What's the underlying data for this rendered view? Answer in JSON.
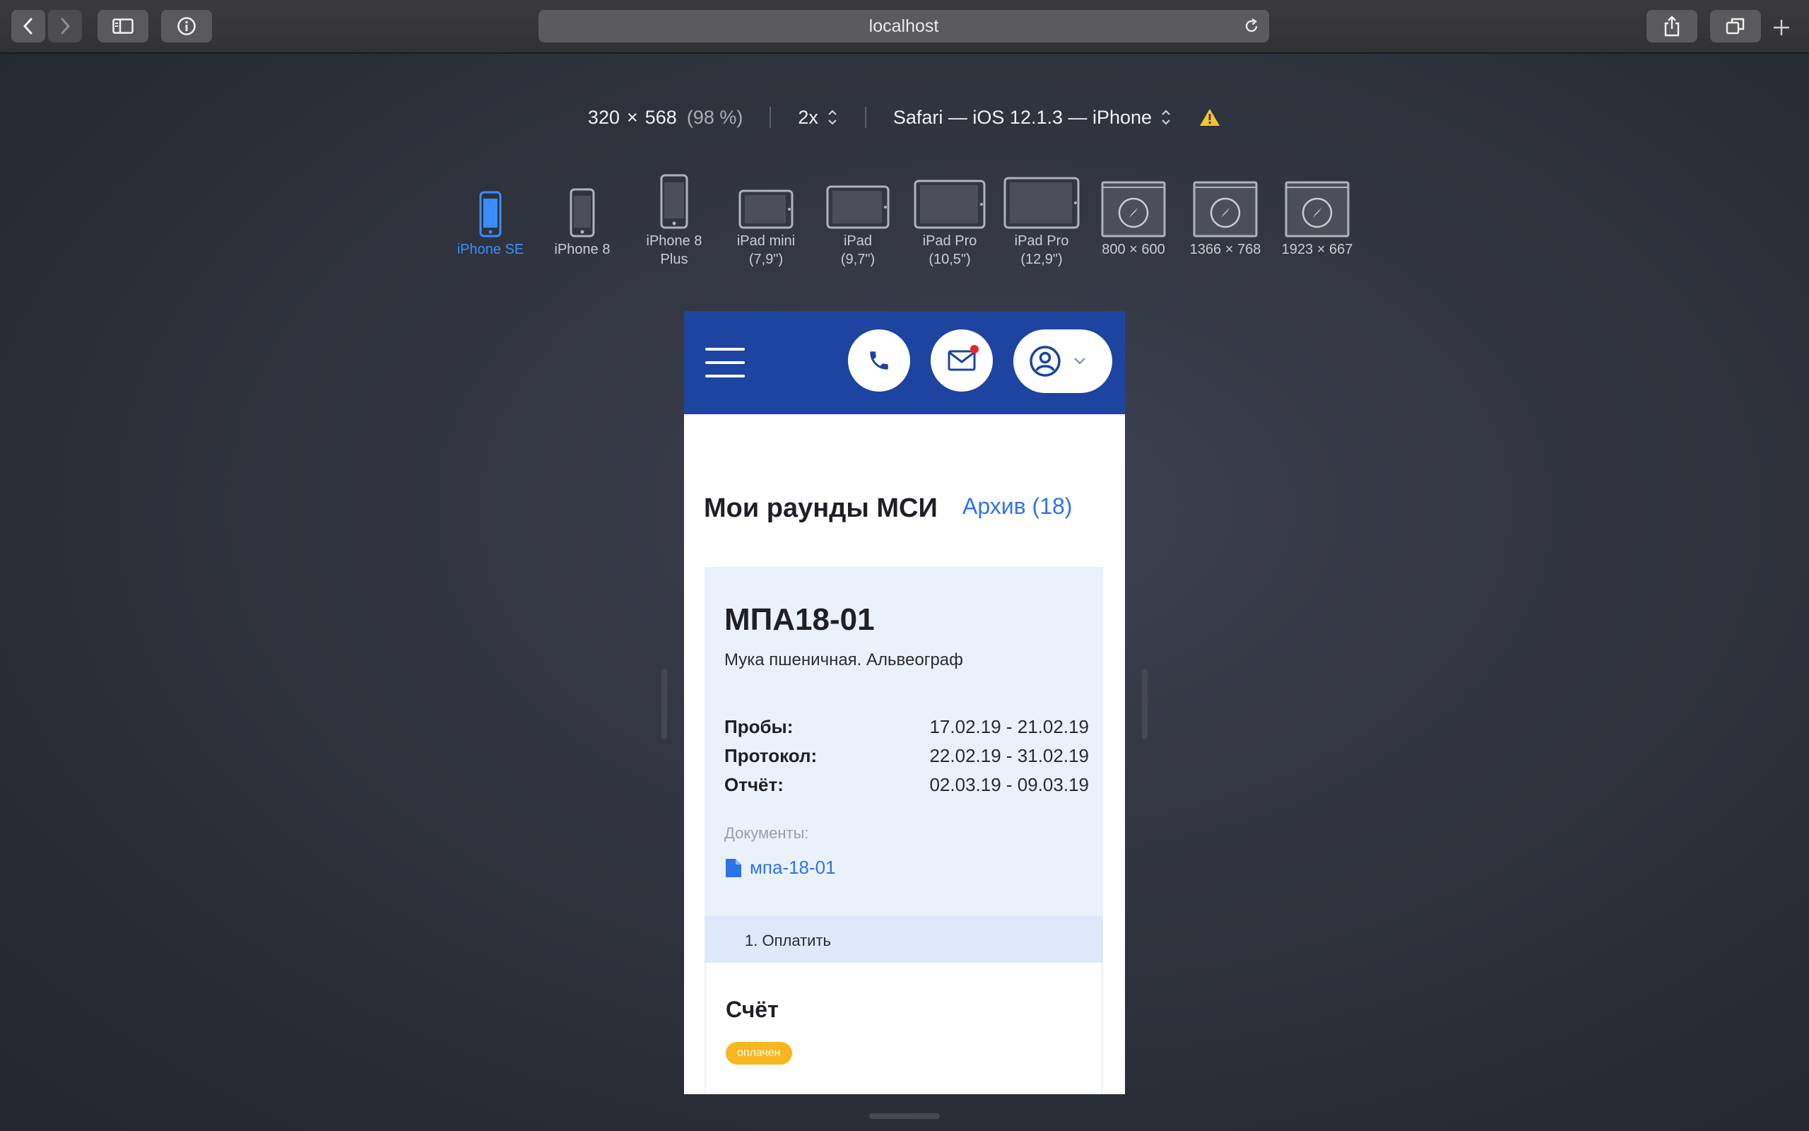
{
  "browser": {
    "url": "localhost"
  },
  "responsive": {
    "width": "320",
    "times": "×",
    "height": "568",
    "zoom": "(98 %)",
    "scale": "2x",
    "user_agent": "Safari — iOS 12.1.3 — iPhone"
  },
  "devices": [
    {
      "line1": "iPhone SE",
      "line2": ""
    },
    {
      "line1": "iPhone 8",
      "line2": ""
    },
    {
      "line1": "iPhone 8",
      "line2": "Plus"
    },
    {
      "line1": "iPad mini",
      "line2": "(7,9\")"
    },
    {
      "line1": "iPad",
      "line2": "(9,7\")"
    },
    {
      "line1": "iPad Pro",
      "line2": "(10,5\")"
    },
    {
      "line1": "iPad Pro",
      "line2": "(12,9\")"
    },
    {
      "line1": "800 × 600",
      "line2": ""
    },
    {
      "line1": "1366 × 768",
      "line2": ""
    },
    {
      "line1": "1923 × 667",
      "line2": ""
    }
  ],
  "site": {
    "title": "Мои раунды МСИ",
    "archive": "Архив (18)",
    "card": {
      "code": "МПА18-01",
      "description": "Мука пшеничная. Альвеограф",
      "dates": [
        {
          "label": "Пробы:",
          "value": "17.02.19 - 21.02.19"
        },
        {
          "label": "Протокол:",
          "value": "22.02.19 - 31.02.19"
        },
        {
          "label": "Отчёт:",
          "value": "02.03.19 - 09.03.19"
        }
      ],
      "docs_label": "Документы:",
      "doc_link": "мпа-18-01",
      "step": "1. Оплатить"
    },
    "invoice": {
      "title": "Счёт",
      "status": "оплачен"
    }
  },
  "colors": {
    "header": "#1c44a0",
    "link": "#2f74e6",
    "badge": "#f6b720",
    "card_bg": "#ebf1fb",
    "active_device": "#3a8dff"
  }
}
